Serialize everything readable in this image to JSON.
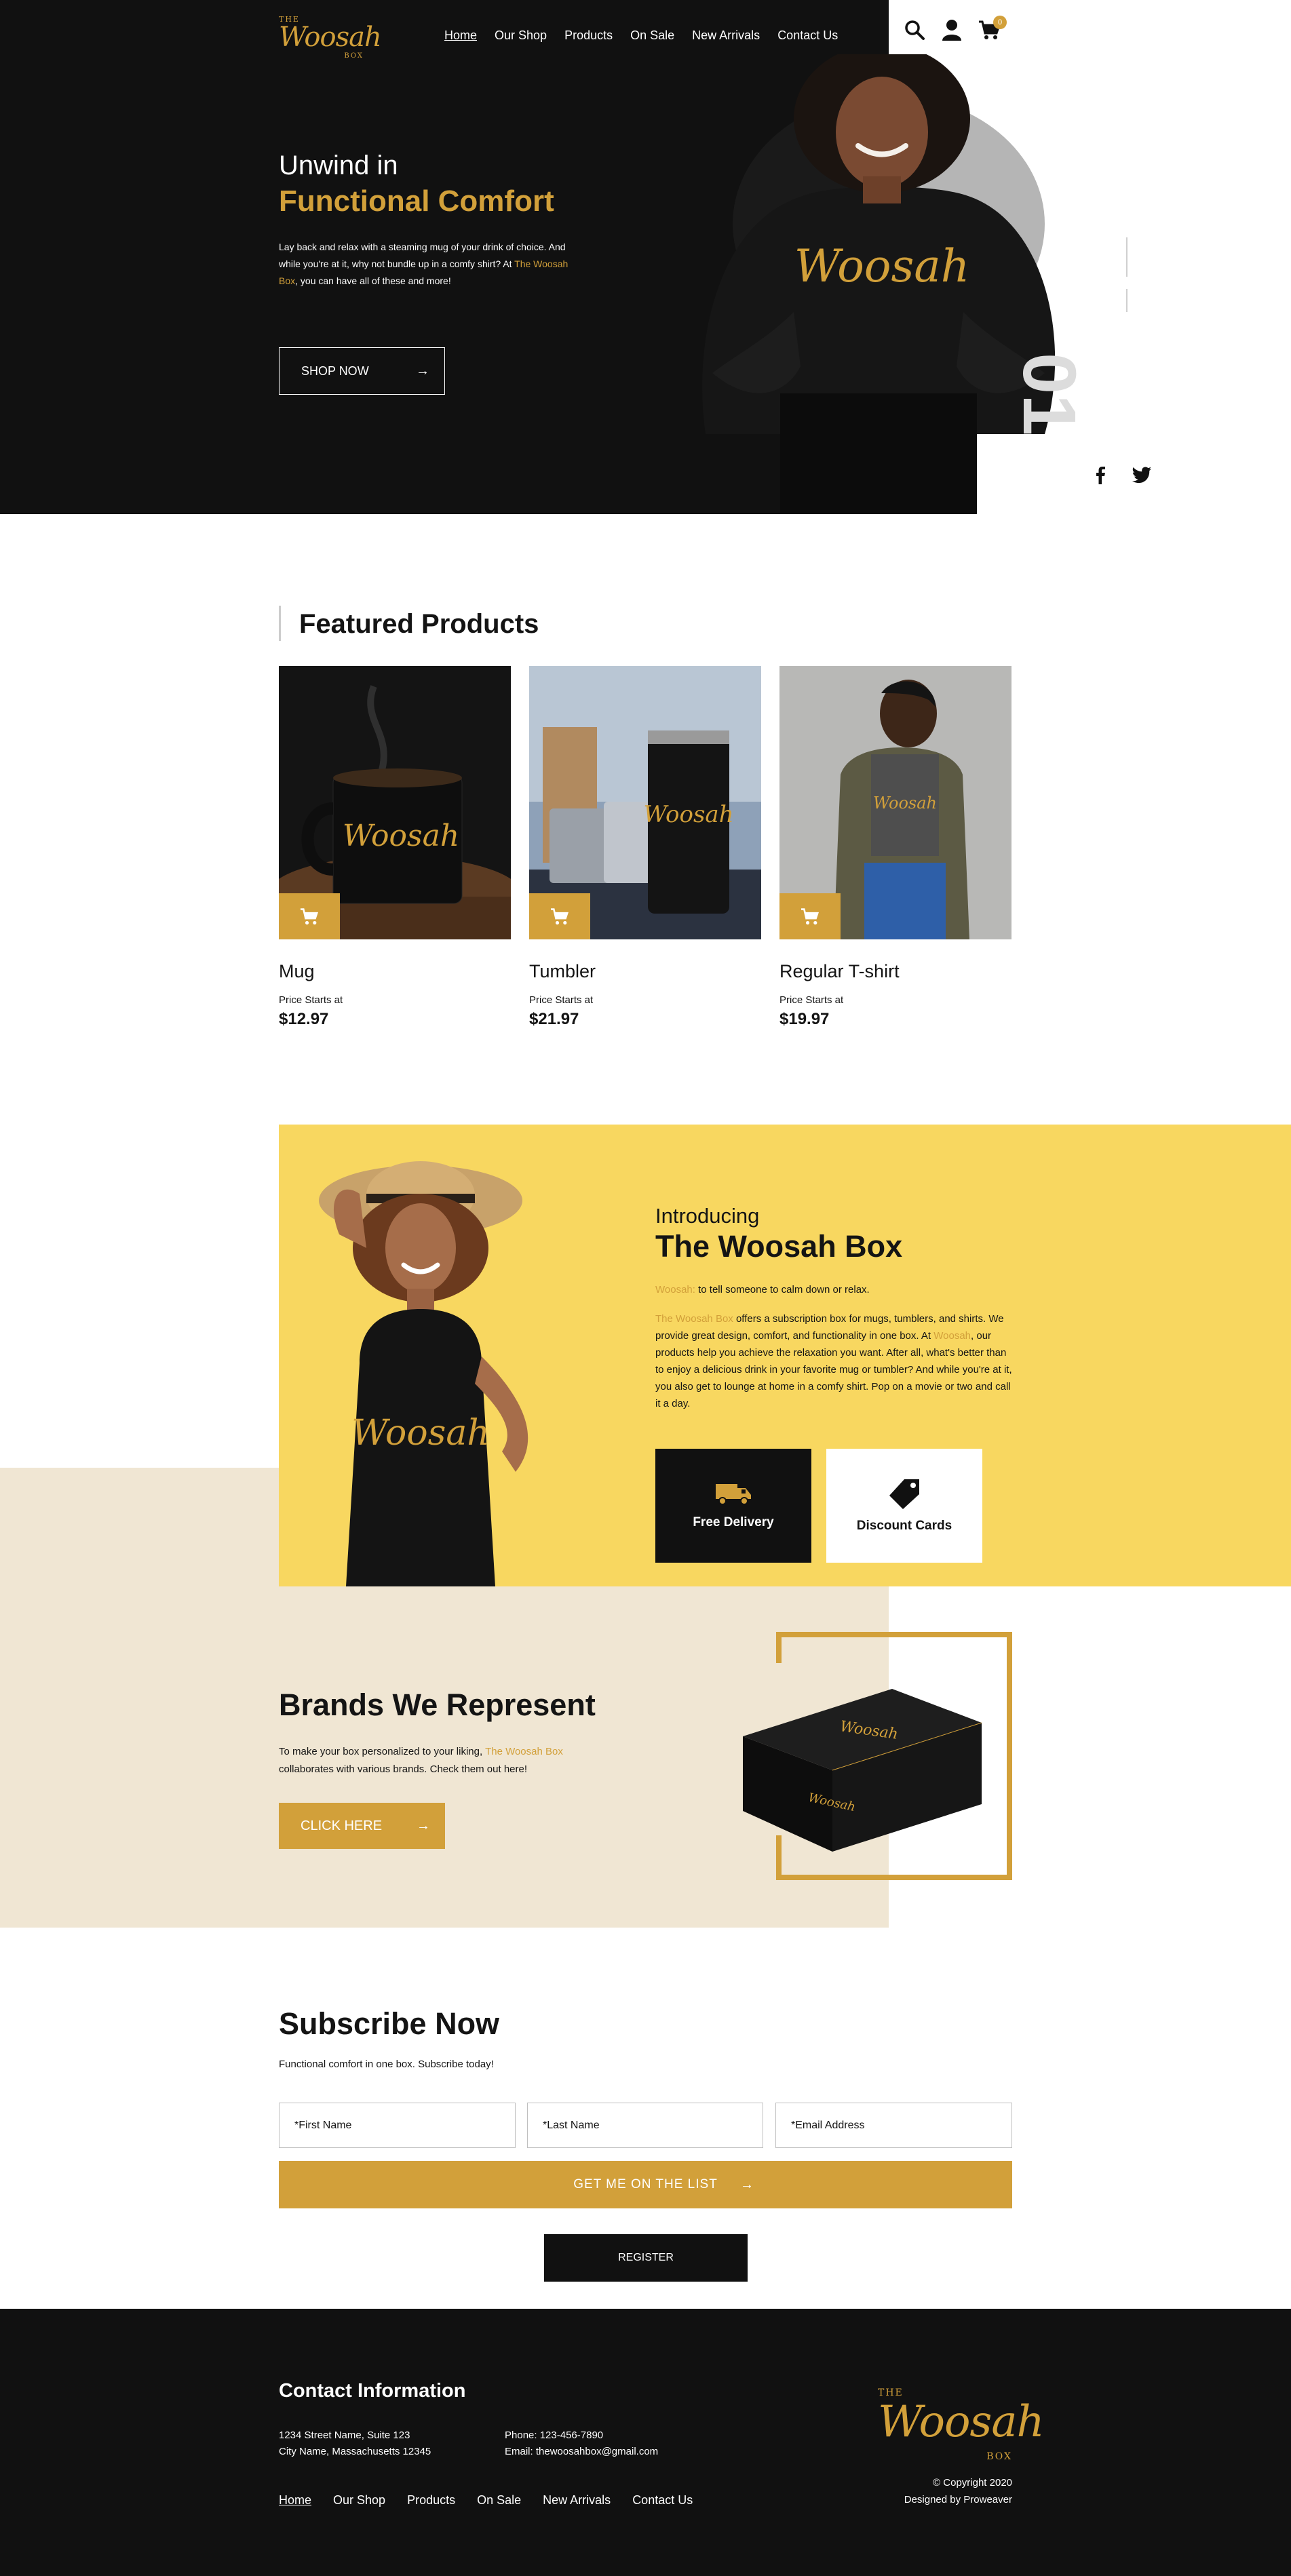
{
  "brand": {
    "logo_the": "THE",
    "logo_word": "Woosah",
    "logo_box": "BOX",
    "accent_color": "#d2a03a",
    "dark_color": "#111111",
    "yellow_color": "#f8d760",
    "beige_color": "#f0e6d3"
  },
  "nav": {
    "items": [
      "Home",
      "Our Shop",
      "Products",
      "On Sale",
      "New Arrivals",
      "Contact Us"
    ],
    "active": "Home"
  },
  "header_icons": {
    "search": "search-icon",
    "account": "user-icon",
    "cart": "cart-icon",
    "cart_count": "0"
  },
  "hero": {
    "title_line1": "Unwind in",
    "title_line2": "Functional Comfort",
    "body_before": "Lay back and relax with a steaming mug of your drink of choice. And while you're at it, why not bundle up in a comfy shirt? At ",
    "body_brand": "The Woosah Box",
    "body_after": ", you can have all of these and more!",
    "button": "SHOP NOW",
    "slide_number": "01",
    "shirt_text": "Woosah",
    "social": [
      "facebook-icon",
      "twitter-icon"
    ]
  },
  "featured": {
    "title": "Featured Products",
    "products": [
      {
        "name": "Mug",
        "starts_label": "Price Starts at",
        "price": "$12.97",
        "print": "Woosah"
      },
      {
        "name": "Tumbler",
        "starts_label": "Price Starts at",
        "price": "$21.97",
        "print": "Woosah"
      },
      {
        "name": "Regular T-shirt",
        "starts_label": "Price Starts at",
        "price": "$19.97",
        "print": "Woosah"
      }
    ]
  },
  "intro": {
    "kicker": "Introducing",
    "title": "The Woosah Box",
    "def_word": "Woosah:",
    "def_text": " to tell someone to calm down or relax.",
    "p_brand": "The Woosah Box",
    "p_part1": " offers a subscription box for mugs, tumblers, and shirts. We provide great design, comfort, and functionality in one box. At ",
    "p_brand2": "Woosah",
    "p_part2": ", our products help you achieve the relaxation you want. After all, what's better than to enjoy a delicious drink in your favorite mug or tumbler? And while you're at it, you also get to lounge at home in a comfy shirt. Pop on a movie or two and call it a day.",
    "tank_text": "Woosah",
    "features": [
      {
        "label": "Free Delivery",
        "icon": "truck-icon"
      },
      {
        "label": "Discount Cards",
        "icon": "tag-icon"
      }
    ]
  },
  "brands": {
    "title": "Brands We Represent",
    "body_before": "To make your box personalized to your liking, ",
    "body_brand": "The Woosah Box",
    "body_after": " collaborates with various brands. Check them out here!",
    "button": "CLICK HERE",
    "box_print": "Woosah"
  },
  "subscribe": {
    "title": "Subscribe Now",
    "subtitle": "Functional comfort in one box. Subscribe today!",
    "first_name_placeholder": "*First Name",
    "last_name_placeholder": "*Last Name",
    "email_placeholder": "*Email Address",
    "list_button": "GET ME ON THE LIST",
    "register_button": "REGISTER"
  },
  "footer": {
    "title": "Contact Information",
    "address_line1": "1234 Street Name, Suite 123",
    "address_line2": "City Name, Massachusetts 12345",
    "phone": "Phone: 123-456-7890",
    "email": "Email: thewoosahbox@gmail.com",
    "nav": [
      "Home",
      "Our Shop",
      "Products",
      "On Sale",
      "New Arrivals",
      "Contact Us"
    ],
    "copyright": "© Copyright 2020",
    "designed_by": "Designed by Proweaver"
  }
}
